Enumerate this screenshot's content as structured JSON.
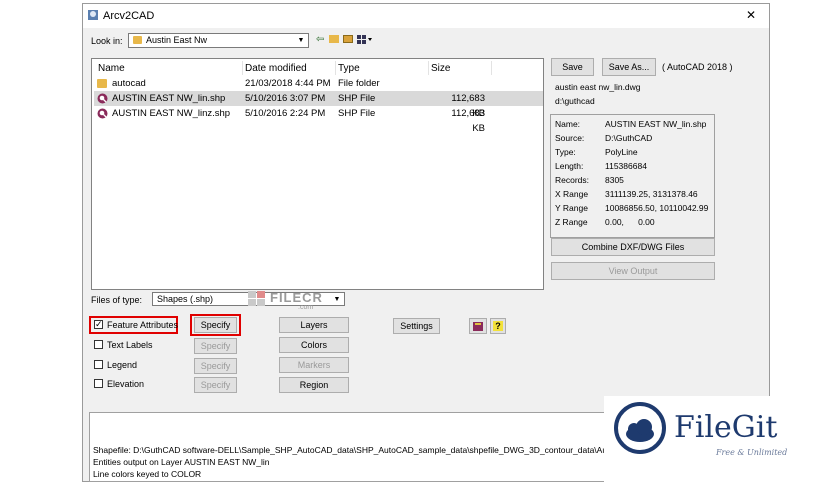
{
  "window": {
    "title": "Arcv2CAD",
    "close_glyph": "✕"
  },
  "lookin": {
    "label": "Look in:",
    "value": "Austin East Nw"
  },
  "columns": [
    "Name",
    "Date modified",
    "Type",
    "Size"
  ],
  "files": [
    {
      "icon": "folder-icon",
      "name": "autocad",
      "date": "21/03/2018 4:44 PM",
      "type": "File folder",
      "size": ""
    },
    {
      "icon": "shp-file-icon",
      "name": "AUSTIN EAST NW_lin.shp",
      "date": "5/10/2016 3:07 PM",
      "type": "SHP File",
      "size": "112,683 KB"
    },
    {
      "icon": "shp-file-icon",
      "name": "AUSTIN EAST NW_linz.shp",
      "date": "5/10/2016 2:24 PM",
      "type": "SHP File",
      "size": "112,683 KB"
    }
  ],
  "right_panel": {
    "save_label": "Save",
    "save_as_label": "Save As...",
    "format_label": "( AutoCAD 2018 )",
    "output_file": "austin east nw_lin.dwg",
    "output_dir": "d:\\guthcad",
    "info": [
      {
        "label": "Name:",
        "value": "AUSTIN EAST NW_lin.shp"
      },
      {
        "label": "Source:",
        "value": "D:\\GuthCAD"
      },
      {
        "label": "Type:",
        "value": "PolyLine"
      },
      {
        "label": "Length:",
        "value": "115386684"
      },
      {
        "label": "Records:",
        "value": "8305"
      },
      {
        "label": "X Range",
        "value": "3111139.25, 3131378.46"
      },
      {
        "label": "Y Range",
        "value": "10086856.50, 10110042.99"
      },
      {
        "label": "Z Range",
        "value": "0.00,      0.00"
      }
    ],
    "combine_label": "Combine DXF/DWG Files",
    "view_output_label": "View Output"
  },
  "filetype": {
    "label": "Files of type:",
    "value": "Shapes (.shp)"
  },
  "options": [
    {
      "label": "Feature Attributes",
      "checked": true,
      "specify": "Specify",
      "specify_enabled": true
    },
    {
      "label": "Text Labels",
      "checked": false,
      "specify": "Specify",
      "specify_enabled": false
    },
    {
      "label": "Legend",
      "checked": false,
      "specify": "Specify",
      "specify_enabled": false
    },
    {
      "label": "Elevation",
      "checked": false,
      "specify": "Specify",
      "specify_enabled": false
    }
  ],
  "middle_buttons": {
    "layers": "Layers",
    "colors": "Colors",
    "markers": "Markers",
    "region": "Region"
  },
  "settings_label": "Settings",
  "status_lines": [
    "Shapefile: D:\\GuthCAD software-DELL\\Sample_SHP_AutoCAD_data\\SHP_AutoCAD_sample_data\\shpefile_DWG_3D_contour_data\\Austin East Nw",
    "Entities output on Layer AUSTIN EAST NW_lin",
    "Line colors keyed to COLOR"
  ],
  "watermarks": {
    "filecr": "FILECR",
    "filecr_sub": ".com",
    "filegit": "FileGit",
    "filegit_sub": "Free & Unlimited"
  },
  "colors": {
    "highlight_red": "#e00000",
    "filegit_blue": "#1e3a6e"
  }
}
